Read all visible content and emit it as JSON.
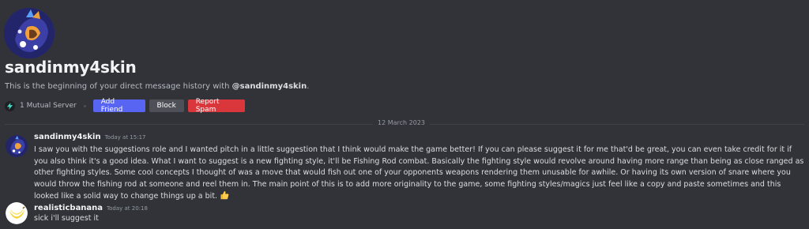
{
  "intro": {
    "username": "sandinmy4skin",
    "subtitle_prefix": "This is the beginning of your direct message history with ",
    "subtitle_handle": "@sandinmy4skin",
    "subtitle_suffix": "."
  },
  "actions": {
    "mutual_servers": "1 Mutual Server",
    "add_friend": "Add Friend",
    "block": "Block",
    "report_spam": "Report Spam"
  },
  "divider": {
    "date": "12 March 2023"
  },
  "messages": [
    {
      "author": "sandinmy4skin",
      "timestamp": "Today at 15:17",
      "text": "I saw you with the suggestions role and I wanted pitch in a little suggestion that I think would make the game better! If you can please suggest it for me that'd be great, you can even take credit for it if you also think it's a good idea. What I want to suggest is a new fighting style, it'll be Fishing Rod combat. Basically the fighting style would revolve around having more range than being as close ranged as other fighting styles. Some cool concepts I thought of was a move that would fish out one of your opponents weapons rendering them unusable for awhile. Or having its own version of snare where you would throw the fishing rod at someone and reel them in. The main point of this is to add more originality to the game, some fighting styles/magics just feel like a copy and paste sometimes and this looked like a solid way to change things up a bit.",
      "emoji": "thumbs-up-icon"
    },
    {
      "author": "realisticbanana",
      "timestamp": "Today at 20:18",
      "text": "sick i'll suggest it"
    }
  ],
  "colors": {
    "background": "#313338",
    "blurple": "#5865f2",
    "danger": "#da373c",
    "secondary": "#4e5058"
  }
}
